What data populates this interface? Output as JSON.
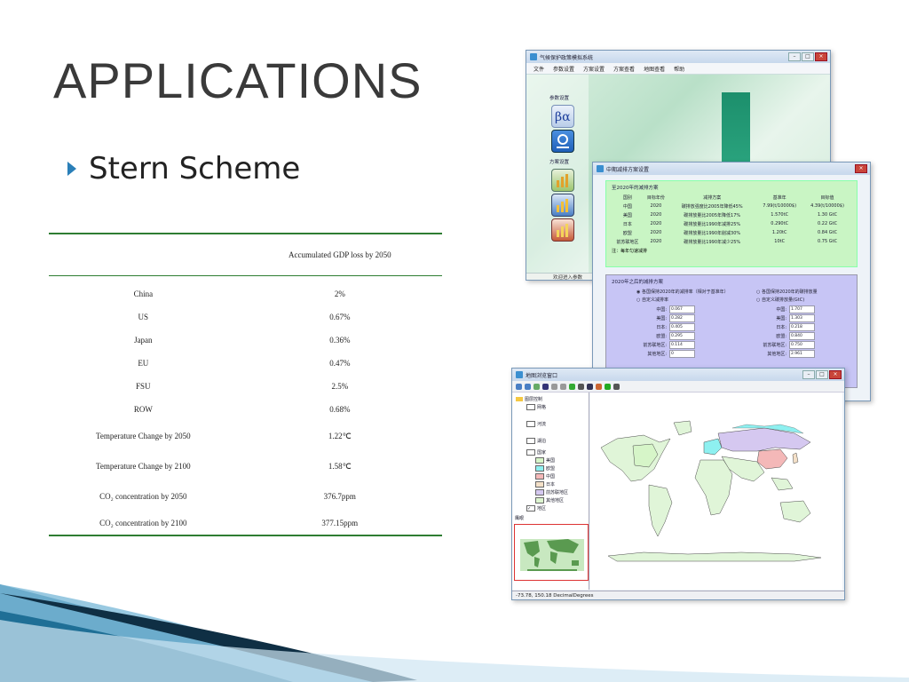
{
  "slide": {
    "title": "APPLICATIONS",
    "bullet": "Stern Scheme"
  },
  "results_table": {
    "header": "Accumulated GDP loss by 2050",
    "rows": [
      {
        "label": "China",
        "value": "2%"
      },
      {
        "label": "US",
        "value": "0.67%"
      },
      {
        "label": "Japan",
        "value": "0.36%"
      },
      {
        "label": "EU",
        "value": "0.47%"
      },
      {
        "label": "FSU",
        "value": "2.5%"
      },
      {
        "label": "ROW",
        "value": "0.68%"
      },
      {
        "label": "Temperature Change by 2050",
        "value": "1.22℃"
      },
      {
        "label": "Temperature Change by 2100",
        "value": "1.58℃"
      },
      {
        "label": "CO₂ concentration   by 2050",
        "value": "376.7ppm"
      },
      {
        "label": "CO₂ concentration by 2100",
        "value": "377.15ppm"
      }
    ]
  },
  "main_window": {
    "title": "气候保护政策模拟系统",
    "menu": [
      "文件",
      "参数设置",
      "方案设置",
      "方案查看",
      "地图查看",
      "帮助"
    ],
    "side_param_label": "参数设置",
    "side_scheme_label": "方案设置",
    "status": "欢迎进入参数"
  },
  "scheme_window": {
    "title": "中期减排方案设置",
    "group1_title": "至2020年的减排方案",
    "table_headers": [
      "国别",
      "目标年份",
      "减排方案",
      "基准年",
      "目标值"
    ],
    "table_rows": [
      [
        "中国",
        "2020",
        "碳排放强度比2005年降低45%",
        "7.99(t/10000$)",
        "4.39(t/10000$)"
      ],
      [
        "美国",
        "2020",
        "碳排放量比2005年降低17%",
        "1.570tC",
        "1.30 GtC"
      ],
      [
        "日本",
        "2020",
        "碳排放量比1990年减排25%",
        "0.290tC",
        "0.22 GtC"
      ],
      [
        "欧盟",
        "2020",
        "碳排放量比1990年削减30%",
        "1.20tC",
        "0.84 GtC"
      ],
      [
        "前苏联地区",
        "2020",
        "碳排放量比1990年减少25%",
        "10tC",
        "0.75 GtC"
      ]
    ],
    "note": "注：每年匀速减排",
    "group2_title": "2020年之后的减排方案",
    "radio_1": "各国保持2020年的减排率（相对于基准年）",
    "radio_2": "各国保持2020年的碳排放量",
    "radio_3": "自定义减排率",
    "radio_4": "自定义碳排放量(GtC)",
    "left_fields": [
      {
        "label": "中国:",
        "value": "0.067"
      },
      {
        "label": "美国:",
        "value": "0.282"
      },
      {
        "label": "日本:",
        "value": "0.405"
      },
      {
        "label": "欧盟:",
        "value": "0.295"
      },
      {
        "label": "前苏联地区:",
        "value": "0.114"
      },
      {
        "label": "其他地区:",
        "value": "0"
      }
    ],
    "right_fields": [
      {
        "label": "中国:",
        "value": "1.707"
      },
      {
        "label": "美国:",
        "value": "1.303"
      },
      {
        "label": "日本:",
        "value": "0.218"
      },
      {
        "label": "欧盟:",
        "value": "0.840"
      },
      {
        "label": "前苏联地区:",
        "value": "0.750"
      },
      {
        "label": "其他地区:",
        "value": "2.961"
      }
    ]
  },
  "map_window": {
    "title": "地图浏览窗口",
    "layers": [
      "图层控制",
      "网格",
      "河流",
      "湖泊",
      "国家",
      "美国",
      "欧盟",
      "中国",
      "日本",
      "前苏联地区",
      "其他地区",
      "地区"
    ],
    "overview_label": "鹰眼",
    "status": "-73.78, 150.18  DecimalDegrees"
  }
}
